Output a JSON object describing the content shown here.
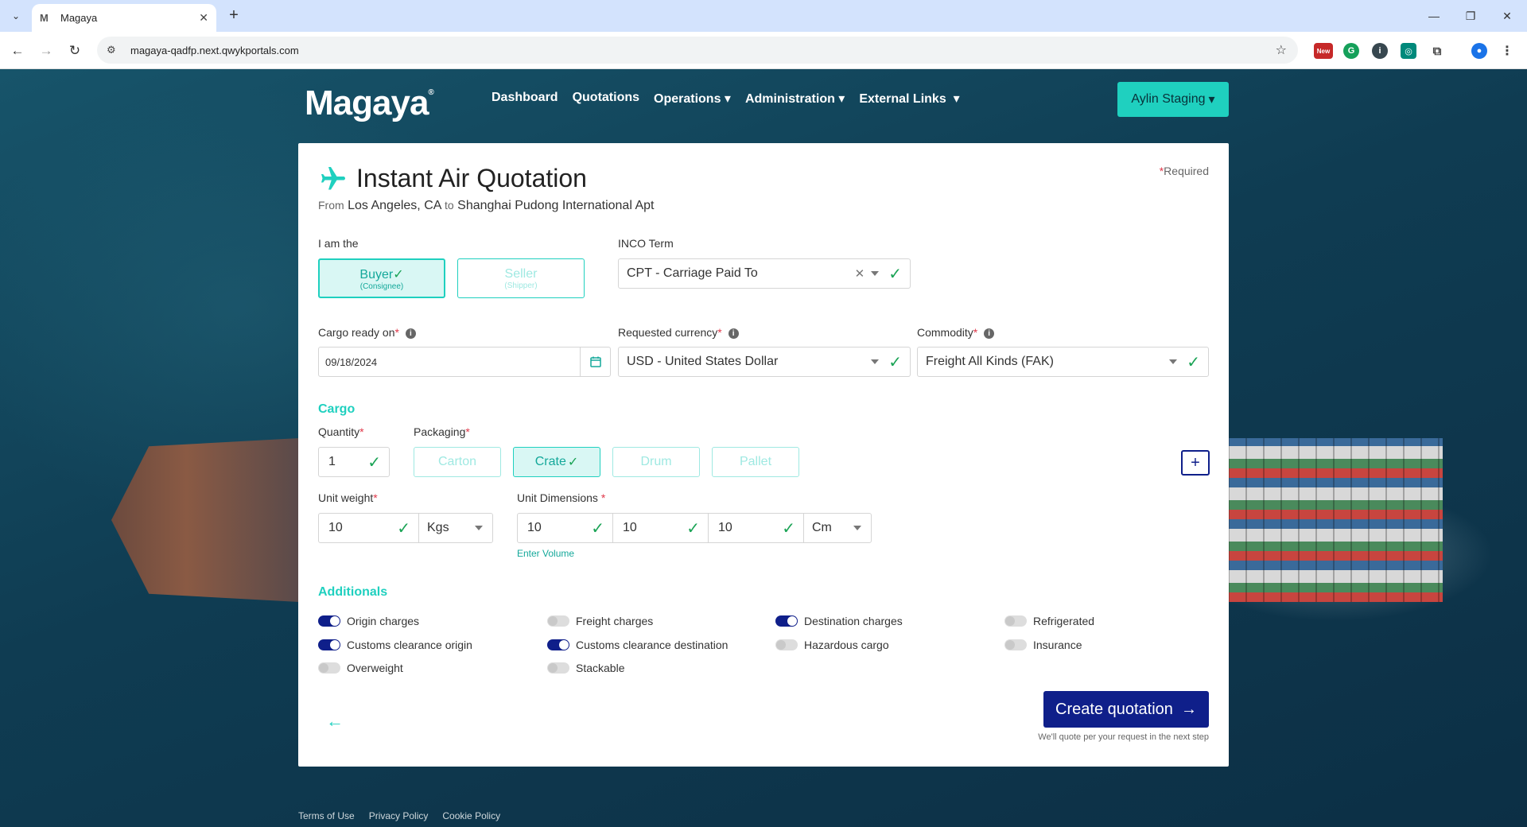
{
  "browser": {
    "tab_title": "Magaya",
    "tab_favicon": "M",
    "url": "magaya-qadfp.next.qwykportals.com",
    "ext_new_label": "New"
  },
  "nav": {
    "logo": "Magaya",
    "items": [
      "Dashboard",
      "Quotations",
      "Operations",
      "Administration",
      "External Links"
    ],
    "user_button": "Aylin Staging"
  },
  "form": {
    "required_note": "Required",
    "title": "Instant Air Quotation",
    "route": {
      "from_word": "From",
      "origin": "Los Angeles, CA",
      "to_word": "to",
      "destination": "Shanghai Pudong International Apt"
    },
    "i_am_the_label": "I am the",
    "roles": [
      {
        "label": "Buyer",
        "sub": "(Consignee)",
        "active": true
      },
      {
        "label": "Seller",
        "sub": "(Shipper)",
        "active": false
      }
    ],
    "inco_label": "INCO Term",
    "inco_value": "CPT - Carriage Paid To",
    "cargo_ready_label": "Cargo ready on",
    "cargo_ready_value": "09/18/2024",
    "currency_label": "Requested currency",
    "currency_value": "USD - United States Dollar",
    "commodity_label": "Commodity",
    "commodity_value": "Freight All Kinds (FAK)",
    "cargo_section": "Cargo",
    "quantity_label": "Quantity",
    "quantity_value": "1",
    "packaging_label": "Packaging",
    "packaging": [
      {
        "label": "Carton",
        "active": false
      },
      {
        "label": "Crate",
        "active": true
      },
      {
        "label": "Drum",
        "active": false
      },
      {
        "label": "Pallet",
        "active": false
      }
    ],
    "unit_weight_label": "Unit weight",
    "unit_weight_value": "10",
    "weight_unit": "Kgs",
    "unit_dim_label": "Unit Dimensions",
    "dims": [
      "10",
      "10",
      "10"
    ],
    "dim_unit": "Cm",
    "enter_volume": "Enter Volume",
    "additionals_section": "Additionals",
    "additionals": [
      {
        "label": "Origin charges",
        "on": true
      },
      {
        "label": "Freight charges",
        "on": false
      },
      {
        "label": "Destination charges",
        "on": true
      },
      {
        "label": "Refrigerated",
        "on": false
      },
      {
        "label": "Customs clearance origin",
        "on": true
      },
      {
        "label": "Customs clearance destination",
        "on": true
      },
      {
        "label": "Hazardous cargo",
        "on": false
      },
      {
        "label": "Insurance",
        "on": false
      },
      {
        "label": "Overweight",
        "on": false
      },
      {
        "label": "Stackable",
        "on": false
      }
    ],
    "create_button": "Create quotation",
    "create_note": "We'll quote per your request in the next step"
  },
  "footer": [
    "Terms of Use",
    "Privacy Policy",
    "Cookie Policy"
  ],
  "colors": {
    "accent": "#1fd0bf",
    "primary": "#0f1f8a",
    "check": "#1aa355",
    "required": "#e0384a"
  }
}
